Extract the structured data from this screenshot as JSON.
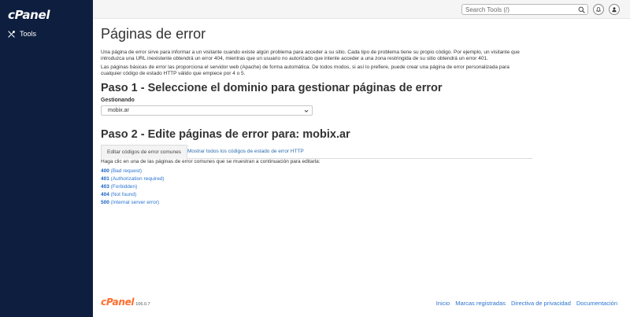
{
  "sidebar": {
    "logo": "cPanel",
    "items": [
      {
        "label": "Tools",
        "icon": "tools-icon"
      }
    ]
  },
  "topbar": {
    "search_placeholder": "Search Tools (/)",
    "search_icon": "search-icon",
    "notifications_icon": "bell-icon",
    "user_icon": "user-icon"
  },
  "main": {
    "title": "Páginas de error",
    "intro_1": "Una página de error sirve para informar a un visitante cuando existe algún problema para acceder a su sitio. Cada tipo de problema tiene su propio código. Por ejemplo, un visitante que introduzca una URL inexistente obtendrá un error 404, mientras que un usuario no autorizado que intente acceder a una zona restringida de su sitio obtendrá un error 401.",
    "intro_2": "Las páginas básicas de error las proporciona el servidor web (Apache) de forma automática. De todos modos, si así lo prefiere, puede crear una página de error personalizada para cualquier código de estado HTTP válido que empiece por 4 o 5.",
    "step1_title": "Paso 1 - Seleccione el dominio para gestionar páginas de error",
    "managing_label": "Gestionando",
    "domain_value": "mobix.ar",
    "step2_title": "Paso 2 - Edite páginas de error para: mobix.ar",
    "tabs": [
      {
        "label": "Editar códigos de error comunes"
      },
      {
        "label": "Mostrar todos los códigos de estado de error HTTP"
      }
    ],
    "help_text": "Haga clic en una de las páginas de error comunes que se muestran a continuación para editarla:",
    "errors": [
      {
        "code": "400",
        "desc": "(Bad request)"
      },
      {
        "code": "401",
        "desc": "(Authorization required)"
      },
      {
        "code": "403",
        "desc": "(Forbidden)"
      },
      {
        "code": "404",
        "desc": "(Not found)"
      },
      {
        "code": "500",
        "desc": "(Internal server error)"
      }
    ]
  },
  "footer": {
    "logo": "cPanel",
    "version": "106.0.7",
    "links": [
      "Inicio",
      "Marcas registradas",
      "Directiva de privacidad",
      "Documentación"
    ]
  },
  "colors": {
    "sidebar_bg": "#0e1e3f",
    "link": "#2b74d1",
    "brand_orange": "#ff6c2c"
  }
}
